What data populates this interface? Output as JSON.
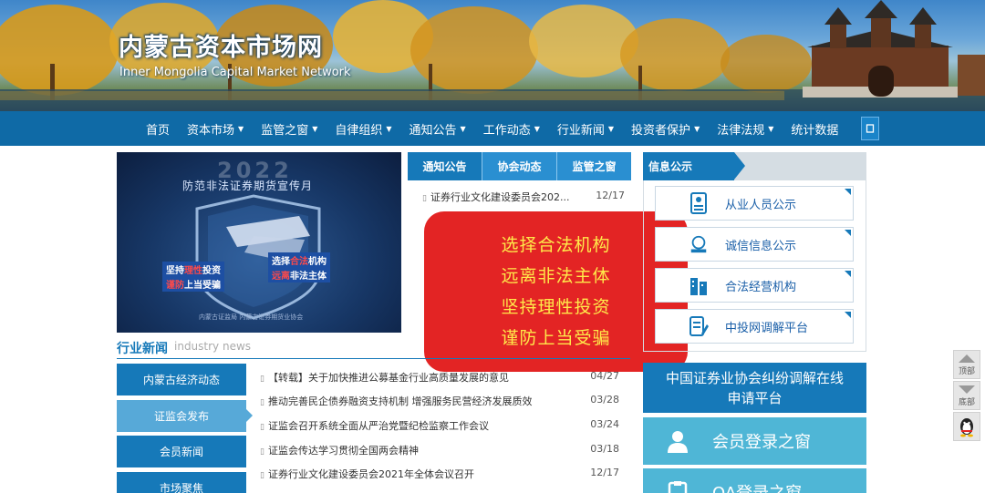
{
  "site": {
    "title": "内蒙古资本市场网",
    "subtitle": "Inner Mongolia Capital Market Network"
  },
  "nav": {
    "items": [
      {
        "label": "首页",
        "caret": ""
      },
      {
        "label": "资本市场",
        "caret": "▼"
      },
      {
        "label": "监管之窗",
        "caret": "▼"
      },
      {
        "label": "自律组织",
        "caret": "▼"
      },
      {
        "label": "通知公告",
        "caret": "▼"
      },
      {
        "label": "工作动态",
        "caret": "▼"
      },
      {
        "label": "行业新闻",
        "caret": "▼"
      },
      {
        "label": "投资者保护",
        "caret": "▼"
      },
      {
        "label": "法律法规",
        "caret": "▼"
      },
      {
        "label": "统计数据",
        "caret": ""
      }
    ],
    "search_icon": "search-icon"
  },
  "poster": {
    "year": "2022",
    "title": "防范非法证券期货宣传月",
    "tag1_a": "坚持",
    "tag1_hl": "理性",
    "tag1_b": "投资",
    "tag2_a": "选择",
    "tag2_hl": "合法",
    "tag2_b": "机构",
    "tag3_hl": "谨防",
    "tag3_b": "上当受骗",
    "tag4_hl": "远离",
    "tag4_b": "非法主体",
    "footer": "内蒙古证监局 内蒙古证券期货业协会"
  },
  "mid_tabs": [
    {
      "label": "通知公告"
    },
    {
      "label": "协会动态"
    },
    {
      "label": "监管之窗"
    }
  ],
  "notices": [
    {
      "title": "证券行业文化建设委员会202...",
      "date": "12/17"
    }
  ],
  "overlay": {
    "lines": [
      "选择合法机构",
      "远离非法主体",
      "坚持理性投资",
      "谨防上当受骗"
    ]
  },
  "info": {
    "title": "信息公示",
    "items": [
      {
        "label": "从业人员公示",
        "icon": "id-card-icon"
      },
      {
        "label": "诚信信息公示",
        "icon": "medal-icon"
      },
      {
        "label": "合法经营机构",
        "icon": "building-icon"
      },
      {
        "label": "中投网调解平台",
        "icon": "document-pen-icon"
      }
    ]
  },
  "industry_news": {
    "title": "行业新闻",
    "title_en": "industry news",
    "categories": [
      {
        "label": "内蒙古经济动态"
      },
      {
        "label": "证监会发布"
      },
      {
        "label": "会员新闻"
      },
      {
        "label": "市场聚焦"
      }
    ],
    "rows": [
      {
        "title": "【转载】关于加快推进公募基金行业高质量发展的意见",
        "date": "04/27"
      },
      {
        "title": "推动完善民企债券融资支持机制 增强服务民营经济发展质效",
        "date": "03/28"
      },
      {
        "title": "证监会召开系统全面从严治党暨纪检监察工作会议",
        "date": "03/24"
      },
      {
        "title": "证监会传达学习贯彻全国两会精神",
        "date": "03/18"
      },
      {
        "title": "证券行业文化建设委员会2021年全体会议召开",
        "date": "12/17"
      }
    ]
  },
  "right": {
    "dispute_line1": "中国证券业协会纠纷调解在线",
    "dispute_line2": "申请平台",
    "member_login": "会员登录之窗",
    "oa_login": "OA登录之窗"
  },
  "tools": {
    "top": "顶部",
    "bottom": "底部",
    "qq_icon": "qq-penguin-icon"
  },
  "colors": {
    "nav_bg": "#0f6aa6",
    "primary": "#1679b9",
    "light_blue": "#57a9d8",
    "overlay_red": "#e32424",
    "overlay_text": "#ffe94a",
    "login_teal": "#4fb6d6"
  }
}
